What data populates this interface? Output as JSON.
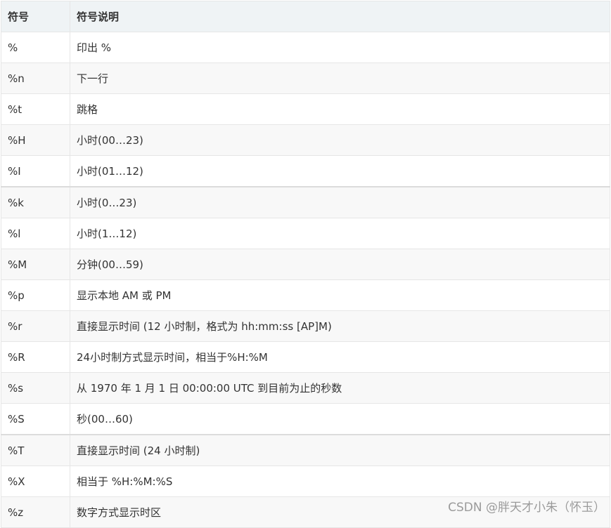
{
  "table": {
    "headers": [
      "符号",
      "符号说明"
    ],
    "rows": [
      {
        "symbol": "%",
        "desc": "印出 %"
      },
      {
        "symbol": "%n",
        "desc": "下一行"
      },
      {
        "symbol": "%t",
        "desc": "跳格"
      },
      {
        "symbol": "%H",
        "desc": "小时(00…23)"
      },
      {
        "symbol": "%I",
        "desc": "小时(01…12)"
      },
      {
        "symbol": "%k",
        "desc": "小时(0…23)"
      },
      {
        "symbol": "%l",
        "desc": "小时(1…12)"
      },
      {
        "symbol": "%M",
        "desc": "分钟(00…59)"
      },
      {
        "symbol": "%p",
        "desc": "显示本地 AM 或 PM"
      },
      {
        "symbol": "%r",
        "desc": "直接显示时间 (12 小时制，格式为 hh:mm:ss [AP]M)"
      },
      {
        "symbol": "%R",
        "desc": "24小时制方式显示时间，相当于%H:%M"
      },
      {
        "symbol": "%s",
        "desc": "从 1970 年 1 月 1 日 00:00:00 UTC 到目前为止的秒数"
      },
      {
        "symbol": "%S",
        "desc": "秒(00…60)"
      },
      {
        "symbol": "%T",
        "desc": "直接显示时间 (24 小时制)"
      },
      {
        "symbol": "%X",
        "desc": "相当于 %H:%M:%S"
      },
      {
        "symbol": "%z",
        "desc": "数字方式显示时区"
      }
    ]
  },
  "watermark": "CSDN @胖天才小朱（怀玉）"
}
